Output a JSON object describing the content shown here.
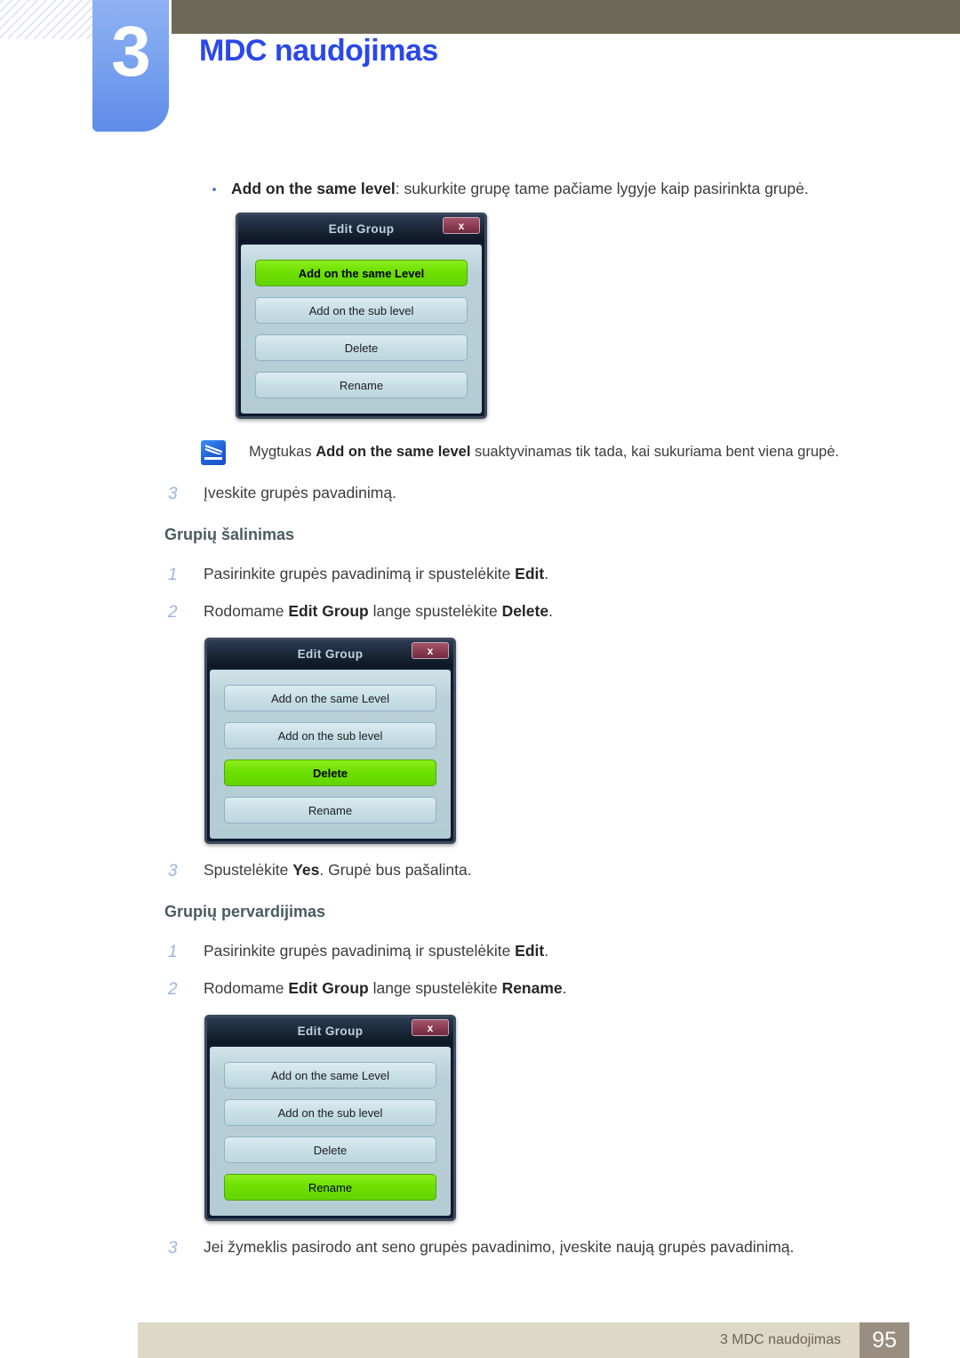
{
  "header": {
    "chapter_number": "3",
    "chapter_title": "MDC naudojimas"
  },
  "body": {
    "bullet": {
      "bold_lead": "Add on the same level",
      "rest": ": sukurkite grupę tame pačiame lygyje kaip pasirinkta grupė."
    },
    "note": {
      "icon": "note-pencil-icon",
      "prefix": "Mygtukas ",
      "bold": "Add on the same level",
      "suffix": " suaktyvinamas tik tada, kai sukuriama bent viena grupė."
    },
    "step_after_note": {
      "index": "3",
      "text": "Įveskite grupės pavadinimą."
    },
    "sections": [
      {
        "heading": "Grupių šalinimas",
        "steps_before": [
          {
            "index": "1",
            "pre": "Pasirinkite grupės pavadinimą ir spustelėkite ",
            "bold": "Edit",
            "post": "."
          },
          {
            "index": "2",
            "pre": "Rodomame ",
            "bold": "Edit Group",
            "post": " lange spustelėkite ",
            "bold2": "Delete",
            "post2": "."
          }
        ],
        "step_after": {
          "index": "3",
          "pre": "Spustelėkite ",
          "bold": "Yes",
          "post": ". Grupė bus pašalinta."
        }
      },
      {
        "heading": "Grupių pervardijimas",
        "steps_before": [
          {
            "index": "1",
            "pre": "Pasirinkite grupės pavadinimą ir spustelėkite ",
            "bold": "Edit",
            "post": "."
          },
          {
            "index": "2",
            "pre": "Rodomame ",
            "bold": "Edit Group",
            "post": " lange spustelėkite ",
            "bold2": "Rename",
            "post2": "."
          }
        ],
        "step_after": {
          "index": "3",
          "pre": "Jei žymeklis pasirodo ant seno grupės pavadinimo, įveskite naują grupės pavadinimą.",
          "bold": "",
          "post": ""
        }
      }
    ]
  },
  "dialogs": [
    {
      "title": "Edit Group",
      "close_label": "x",
      "buttons": [
        {
          "label": "Add on the same Level",
          "highlighted": true
        },
        {
          "label": "Add on the sub level",
          "highlighted": false
        },
        {
          "label": "Delete",
          "highlighted": false
        },
        {
          "label": "Rename",
          "highlighted": false
        }
      ]
    },
    {
      "title": "Edit Group",
      "close_label": "x",
      "buttons": [
        {
          "label": "Add on the same Level",
          "highlighted": false
        },
        {
          "label": "Add on the sub level",
          "highlighted": false
        },
        {
          "label": "Delete",
          "highlighted": true
        },
        {
          "label": "Rename",
          "highlighted": false
        }
      ]
    },
    {
      "title": "Edit Group",
      "close_label": "x",
      "buttons": [
        {
          "label": "Add on the same Level",
          "highlighted": false
        },
        {
          "label": "Add on the sub level",
          "highlighted": false
        },
        {
          "label": "Delete",
          "highlighted": false
        },
        {
          "label": "Rename",
          "highlighted": true
        }
      ]
    }
  ],
  "footer": {
    "text": "3 MDC naudojimas",
    "page": "95"
  },
  "colors": {
    "chapter_title": "#2b48e8",
    "olive_bar": "#6c6a56",
    "tab_blue": "#7aa3ef",
    "footer_bar": "#ded8c6",
    "footer_page_box": "#9a8e80",
    "highlight_green": "#6ee000",
    "dialog_body": "#b9d0d8",
    "dialog_titlebar": "#1b2838",
    "close_button": "#8d3d54"
  }
}
